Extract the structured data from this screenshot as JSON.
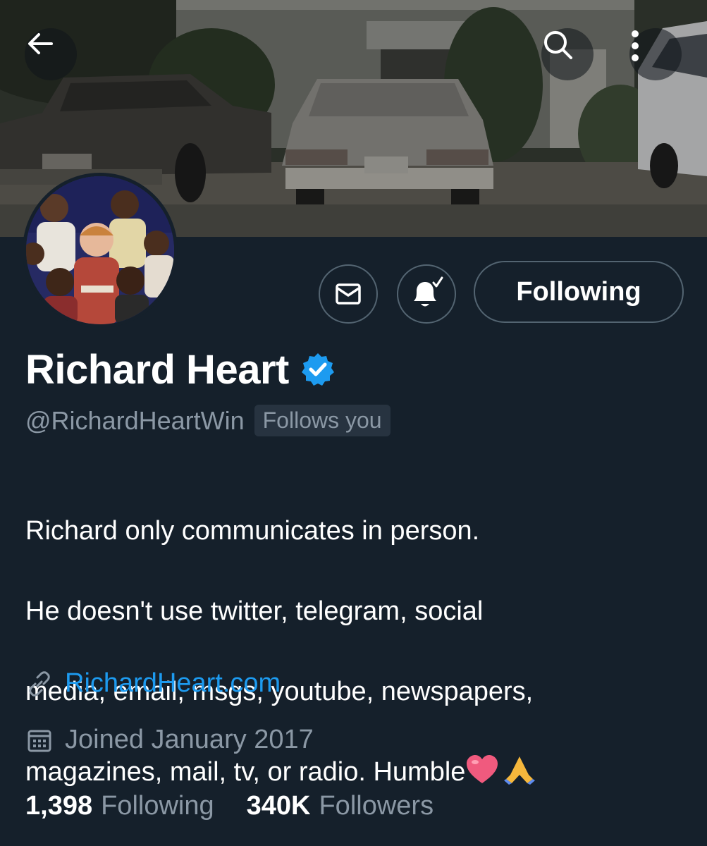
{
  "header": {
    "back_icon": "arrow-left-icon",
    "search_icon": "search-icon",
    "more_icon": "more-vertical-icon"
  },
  "actions": {
    "message_icon": "envelope-icon",
    "notifications_icon": "bell-check-icon",
    "follow_label": "Following"
  },
  "profile": {
    "display_name": "Richard Heart",
    "verified": true,
    "handle": "@RichardHeartWin",
    "follows_you_label": "Follows you",
    "bio_lines": [
      "Richard only communicates in person.",
      "He doesn't use twitter, telegram, social",
      "media, email, msgs, youtube, newspapers,",
      "magazines, mail, tv, or radio. Humble"
    ],
    "bio_emojis": [
      "heart-emoji",
      "folded-hands-emoji"
    ],
    "website": "RichardHeart.com",
    "joined": "Joined January 2017"
  },
  "stats": {
    "following_count": "1,398",
    "following_label": "Following",
    "followers_count": "340K",
    "followers_label": "Followers"
  },
  "colors": {
    "background": "#15202b",
    "accent": "#1d9bf0",
    "secondary_text": "#8b98a5",
    "border": "#536471"
  }
}
